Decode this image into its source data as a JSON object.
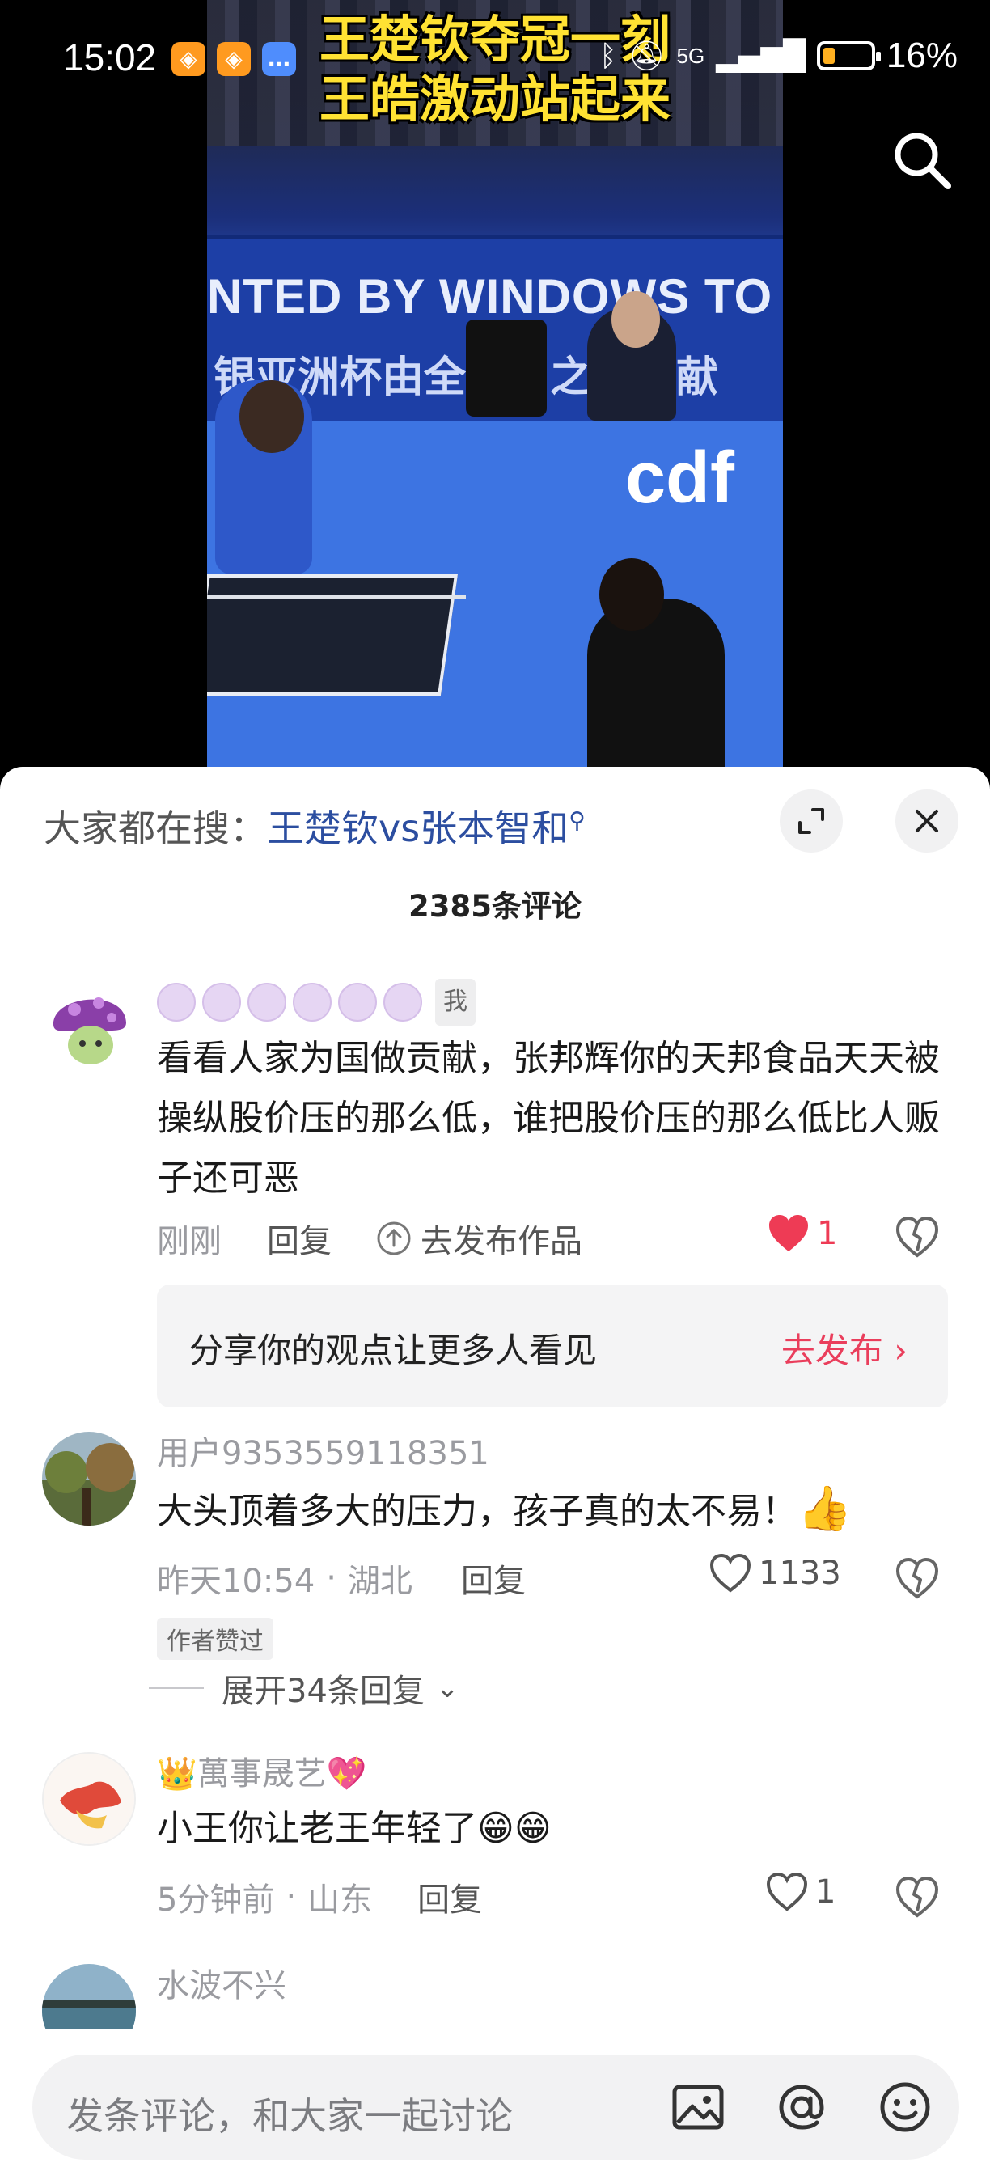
{
  "status_bar": {
    "time": "15:02",
    "battery": "16%",
    "network": "5G"
  },
  "video": {
    "title_line1": "王楚钦夺冠一刻",
    "title_line2": "王皓激动站起来",
    "banner_text": "NTED BY WINDOWS TO G",
    "banner_text2": "银亚洲杯由全球易之窗星献",
    "cdf": "cdf"
  },
  "sheet": {
    "hot_search_prefix": "大家都在搜：",
    "hot_search_keyword": "王楚钦vs张本智和",
    "comment_count": "2385条评论"
  },
  "comments": [
    {
      "tag": "我",
      "text": "看看人家为国做贡献，张邦辉你的天邦食品天天被操纵股价压的那么低，谁把股价压的那么低比人贩子还可恶",
      "time": "刚刚",
      "reply": "回复",
      "publish": "去发布作品",
      "likes": "1",
      "share_prompt": "分享你的观点让更多人看见",
      "share_action": "去发布"
    },
    {
      "user": "用户9353559118351",
      "text": "大头顶着多大的压力，孩子真的太不易！",
      "time": "昨天10:54",
      "location": "湖北",
      "reply": "回复",
      "likes": "1133",
      "author_tag": "作者赞过",
      "expand": "展开34条回复"
    },
    {
      "user": "萬事晟艺",
      "text": "小王你让老王年轻了",
      "time": "5分钟前",
      "location": "山东",
      "reply": "回复",
      "likes": "1"
    },
    {
      "user": "水波不兴"
    }
  ],
  "input": {
    "placeholder": "发条评论，和大家一起讨论"
  },
  "colors": {
    "liked": "#ee3b55",
    "keyword": "#2c4ea0",
    "accent": "#ea3e5c"
  }
}
